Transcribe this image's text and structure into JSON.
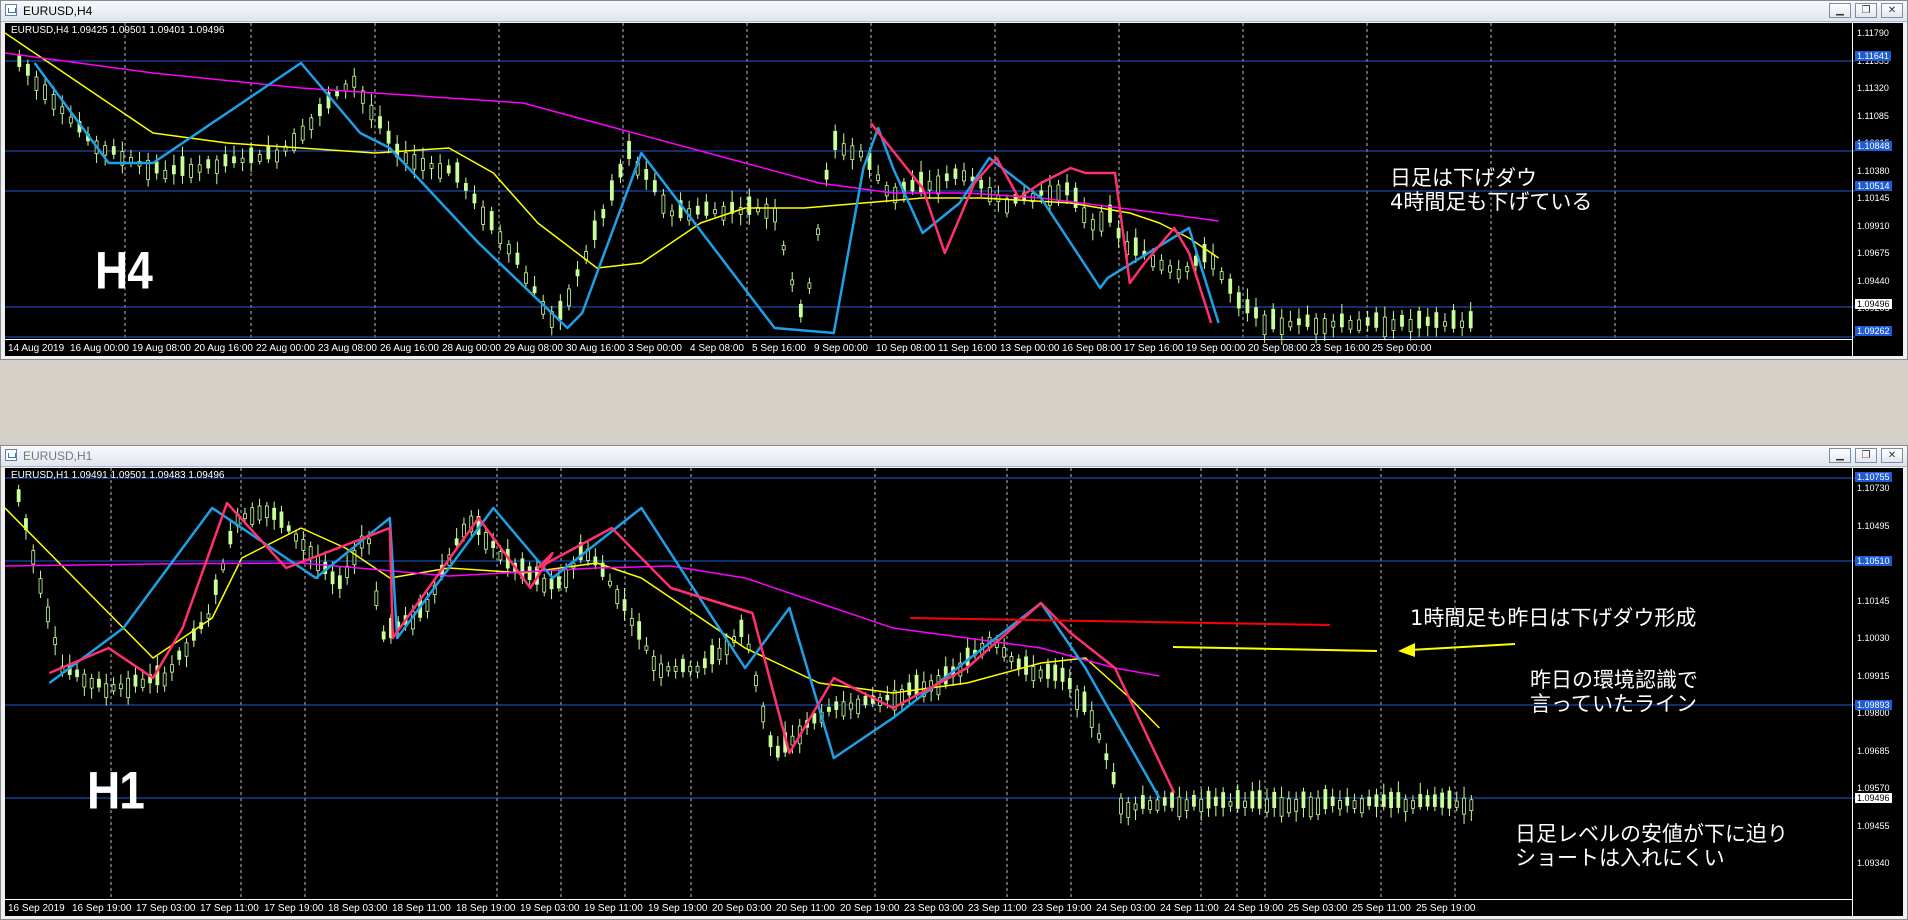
{
  "top": {
    "title": "EURUSD,H4",
    "ohlc": "EURUSD,H4  1.09425 1.09501 1.09401 1.09496",
    "tf_label": "H4",
    "note": "日足は下げダウ\n4時間足も下げている",
    "y_labels": [
      "1.11790",
      "1.11555",
      "1.11320",
      "1.11085",
      "1.10615",
      "1.10380",
      "1.10145",
      "1.09910",
      "1.09675",
      "1.09440",
      "1.09205"
    ],
    "badges": [
      {
        "text": "1.11641",
        "color": "#1e5bd6"
      },
      {
        "text": "1.10848",
        "color": "#1e5bd6"
      },
      {
        "text": "1.10514",
        "color": "#1e5bd6"
      },
      {
        "text": "1.09496",
        "color": "#000000"
      },
      {
        "text": "1.09262",
        "color": "#1e5bd6"
      }
    ],
    "x_labels": [
      "14 Aug 2019",
      "16 Aug 00:00",
      "19 Aug 08:00",
      "20 Aug 16:00",
      "22 Aug 00:00",
      "23 Aug 08:00",
      "26 Aug 16:00",
      "28 Aug 00:00",
      "29 Aug 08:00",
      "30 Aug 16:00",
      "3 Sep 00:00",
      "4 Sep 08:00",
      "5 Sep 16:00",
      "9 Sep 00:00",
      "10 Sep 08:00",
      "11 Sep 16:00",
      "13 Sep 00:00",
      "16 Sep 08:00",
      "17 Sep 16:00",
      "19 Sep 00:00",
      "20 Sep 08:00",
      "23 Sep 16:00",
      "25 Sep 00:00"
    ]
  },
  "bottom": {
    "title": "EURUSD,H1",
    "ohlc": "EURUSD,H1  1.09491 1.09501 1.09483 1.09496",
    "tf_label": "H1",
    "note1": "1時間足も昨日は下げダウ形成",
    "note2": "昨日の環境認識で\n言っていたライン",
    "note3": "日足レベルの安値が下に迫り\nショートは入れにくい",
    "y_labels": [
      "1.10730",
      "1.10495",
      "1.10265",
      "1.10145",
      "1.10030",
      "1.09915",
      "1.09800",
      "1.09685",
      "1.09570",
      "1.09455",
      "1.09340"
    ],
    "badges": [
      {
        "text": "1.10755",
        "color": "#1e5bd6"
      },
      {
        "text": "1.10510",
        "color": "#1e5bd6"
      },
      {
        "text": "1.09893",
        "color": "#1e5bd6"
      },
      {
        "text": "1.09496",
        "color": "#000000"
      }
    ],
    "x_labels": [
      "16 Sep 2019",
      "16 Sep 19:00",
      "17 Sep 03:00",
      "17 Sep 11:00",
      "17 Sep 19:00",
      "18 Sep 03:00",
      "18 Sep 11:00",
      "18 Sep 19:00",
      "19 Sep 03:00",
      "19 Sep 11:00",
      "19 Sep 19:00",
      "20 Sep 03:00",
      "20 Sep 11:00",
      "20 Sep 19:00",
      "23 Sep 03:00",
      "23 Sep 11:00",
      "23 Sep 19:00",
      "24 Sep 03:00",
      "24 Sep 11:00",
      "24 Sep 19:00",
      "25 Sep 03:00",
      "25 Sep 11:00",
      "25 Sep 19:00"
    ]
  },
  "colors": {
    "bull": "#c8ff9a",
    "ma_fast": "#ffff00",
    "ma_slow": "#ff00ff",
    "zz_blue": "#1ea0e6",
    "zz_red": "#ff3070",
    "hline": "#1e5bd6",
    "trend_red": "#ff0000",
    "trend_yellow": "#ffff00"
  }
}
